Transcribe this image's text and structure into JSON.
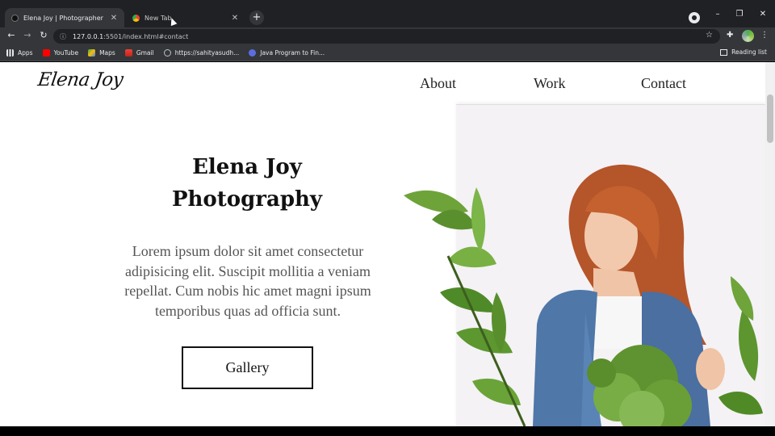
{
  "browser": {
    "tabs": [
      {
        "title": "Elena Joy | Photographer",
        "active": true
      },
      {
        "title": "New Tab",
        "active": false
      }
    ],
    "new_tab_label": "+",
    "url_host": "127.0.0.1",
    "url_rest": ":5501/index.html#contact",
    "window_controls": {
      "minimize": "–",
      "restore": "❐",
      "close": "✕"
    },
    "bookmarks": [
      {
        "label": "Apps",
        "icon": "apps-grid-icon",
        "color": "#e8eaed"
      },
      {
        "label": "YouTube",
        "icon": "youtube-icon",
        "color": "#ff0000"
      },
      {
        "label": "Maps",
        "icon": "maps-icon",
        "color": "#34a853"
      },
      {
        "label": "Gmail",
        "icon": "gmail-icon",
        "color": "#ea4335"
      },
      {
        "label": "https://sahityasudh...",
        "icon": "globe-icon",
        "color": "#bdc1c6"
      },
      {
        "label": "Java Program to Fin...",
        "icon": "java-site-icon",
        "color": "#5b6ee1"
      }
    ],
    "reading_list": "Reading list"
  },
  "site": {
    "logo": "Elena Joy",
    "nav": [
      "About",
      "Work",
      "Contact"
    ],
    "hero_title_line1": "Elena Joy",
    "hero_title_line2": "Photography",
    "hero_text": "Lorem ipsum dolor sit amet consectetur adipisicing elit. Suscipit mollitia a veniam repellat. Cum nobis hic amet magni ipsum temporibus quas ad officia sunt.",
    "gallery_button": "Gallery"
  },
  "colors": {
    "chrome_dark": "#202124",
    "chrome_mid": "#35363a",
    "page_bg": "#ffffff",
    "text": "#111111"
  }
}
